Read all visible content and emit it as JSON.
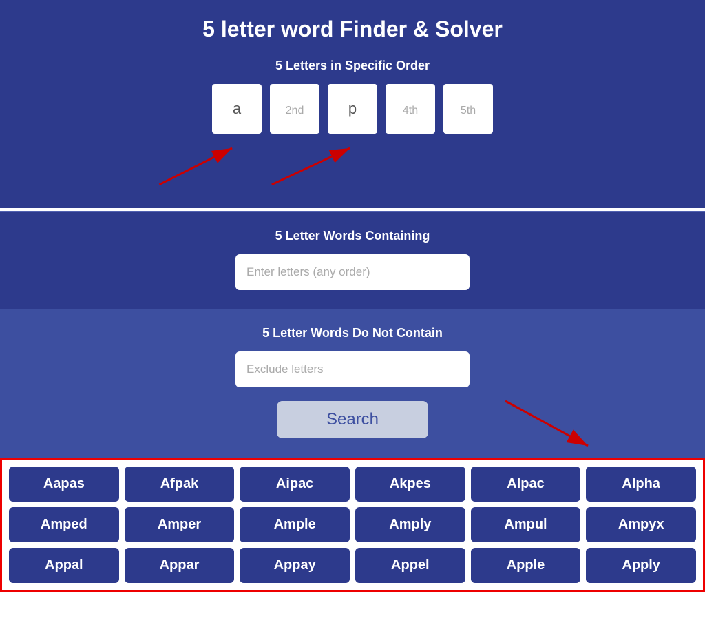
{
  "page": {
    "title": "5 letter word Finder & Solver",
    "specific_order_label": "5 Letters in Specific Order",
    "containing_label": "5 Letter Words Containing",
    "do_not_contain_label": "5 Letter Words Do Not Contain",
    "letter_placeholders": [
      "a",
      "2nd",
      "p",
      "4th",
      "5th"
    ],
    "containing_placeholder": "Enter letters (any order)",
    "exclude_placeholder": "Exclude letters",
    "search_label": "Search",
    "results": [
      "Aapas",
      "Afpak",
      "Aipac",
      "Akpes",
      "Alpac",
      "Alpha",
      "Amped",
      "Amper",
      "Ample",
      "Amply",
      "Ampul",
      "Ampyx",
      "Appal",
      "Appar",
      "Appay",
      "Appel",
      "Apple",
      "Apply"
    ]
  }
}
